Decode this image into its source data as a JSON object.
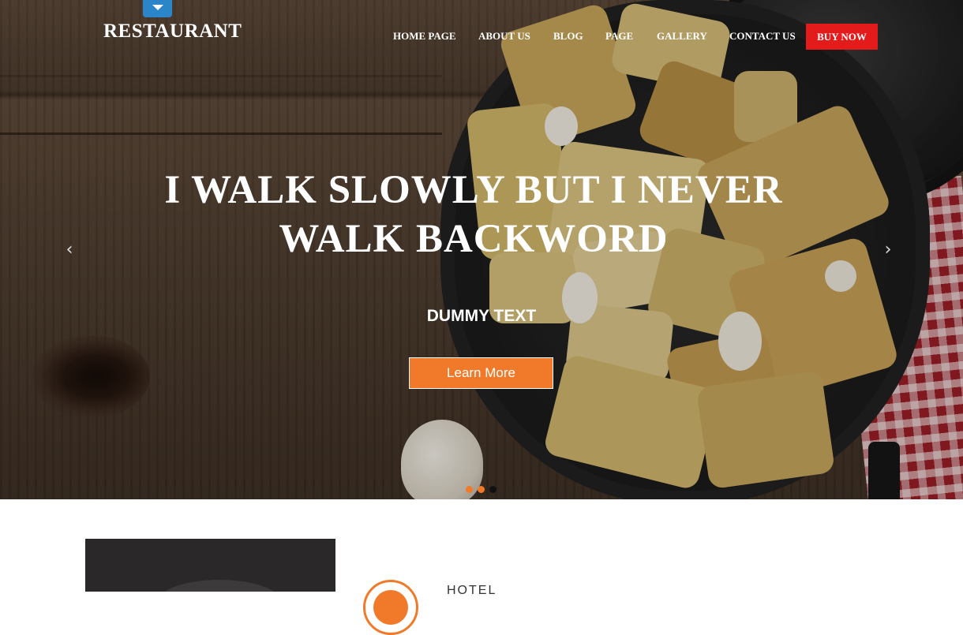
{
  "brand": {
    "logo": "RESTAURANT"
  },
  "nav": {
    "items": [
      {
        "label": "HOME PAGE"
      },
      {
        "label": "ABOUT US"
      },
      {
        "label": "BLOG"
      },
      {
        "label": "PAGE"
      },
      {
        "label": "GALLERY"
      },
      {
        "label": "CONTACT US"
      }
    ],
    "buy_now": "BUY NOW"
  },
  "hero": {
    "headline_line1": "I WALK SLOWLY BUT I NEVER",
    "headline_line2": "WALK BACKWORD",
    "subheading": "DUMMY TEXT",
    "cta_label": "Learn More",
    "prev_icon": "chevron-left-icon",
    "next_icon": "chevron-right-icon",
    "slides_total": 3,
    "active_slide": 2
  },
  "feature": {
    "title": "HOTEL"
  },
  "colors": {
    "accent": "#f07a2a",
    "buy_now": "#e31b1b",
    "logo_tab": "#2a86c8"
  }
}
